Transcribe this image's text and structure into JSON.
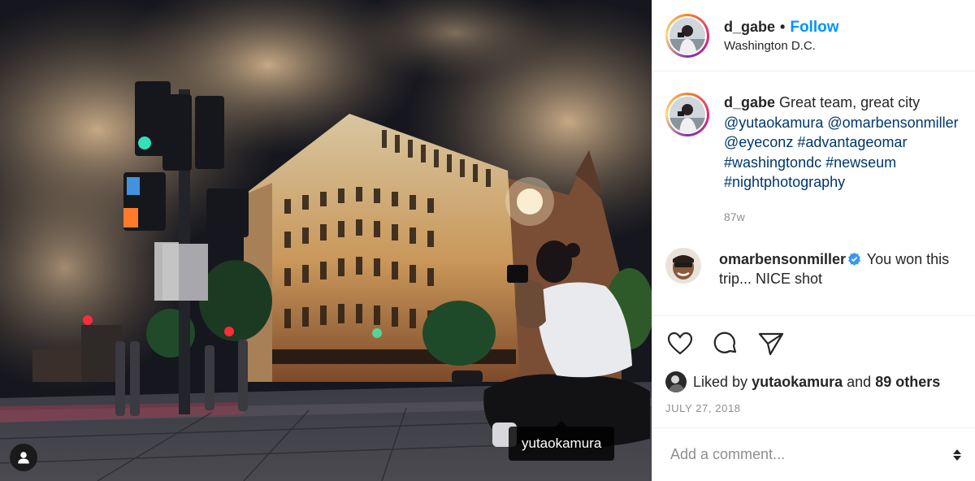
{
  "photo": {
    "tagged_user": "yutaokamura",
    "icons": {
      "user_tag": "user-icon"
    }
  },
  "post_header": {
    "username": "d_gabe",
    "separator": "•",
    "follow_label": "Follow",
    "location": "Washington D.C."
  },
  "caption": {
    "username": "d_gabe",
    "text": "Great team, great city",
    "mentions": [
      "@yutaokamura",
      "@omarbensonmiller",
      "@eyeconz"
    ],
    "hashtags": [
      "#advantageomar",
      "#washingtondc",
      "#newseum",
      "#nightphotography"
    ],
    "ago": "87w"
  },
  "comment": {
    "username": "omarbensonmiller",
    "text": "You won this trip... NICE shot",
    "verified": true
  },
  "actions": {
    "icons": [
      "heart-icon",
      "comment-icon",
      "share-icon"
    ]
  },
  "likes": {
    "prefix": "Liked by",
    "user": "yutaokamura",
    "connector": "and",
    "others": "89 others"
  },
  "date": "JULY 27, 2018",
  "comment_input": {
    "placeholder": "Add a comment..."
  },
  "colors": {
    "link": "#00376b",
    "follow": "#0095f6",
    "verified": "#3897f0",
    "muted": "#8e8e8e"
  }
}
